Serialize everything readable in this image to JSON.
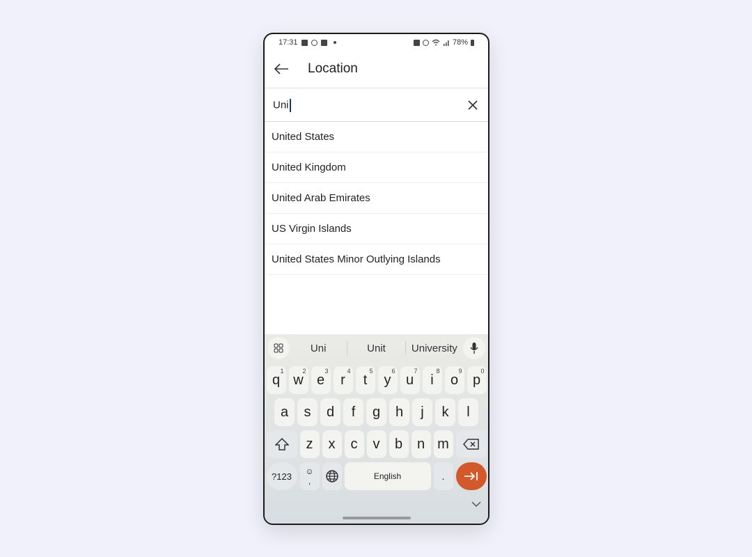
{
  "status_bar": {
    "time": "17:31",
    "battery": "78%"
  },
  "app_bar": {
    "title": "Location"
  },
  "search": {
    "value": "Uni"
  },
  "results": [
    "United States",
    "United Kingdom",
    "United Arab Emirates",
    "US Virgin Islands",
    "United States Minor Outlying Islands"
  ],
  "keyboard": {
    "suggestions": [
      "Uni",
      "Unit",
      "University"
    ],
    "row1": [
      {
        "k": "q",
        "n": "1"
      },
      {
        "k": "w",
        "n": "2"
      },
      {
        "k": "e",
        "n": "3"
      },
      {
        "k": "r",
        "n": "4"
      },
      {
        "k": "t",
        "n": "5"
      },
      {
        "k": "y",
        "n": "6"
      },
      {
        "k": "u",
        "n": "7"
      },
      {
        "k": "i",
        "n": "8"
      },
      {
        "k": "o",
        "n": "9"
      },
      {
        "k": "p",
        "n": "0"
      }
    ],
    "row2": [
      "a",
      "s",
      "d",
      "f",
      "g",
      "h",
      "j",
      "k",
      "l"
    ],
    "row3": [
      "z",
      "x",
      "c",
      "v",
      "b",
      "n",
      "m"
    ],
    "symbols_label": "?123",
    "comma_label": ",",
    "space_label": "English",
    "period_label": ".",
    "accent_color": "#d4592a"
  }
}
